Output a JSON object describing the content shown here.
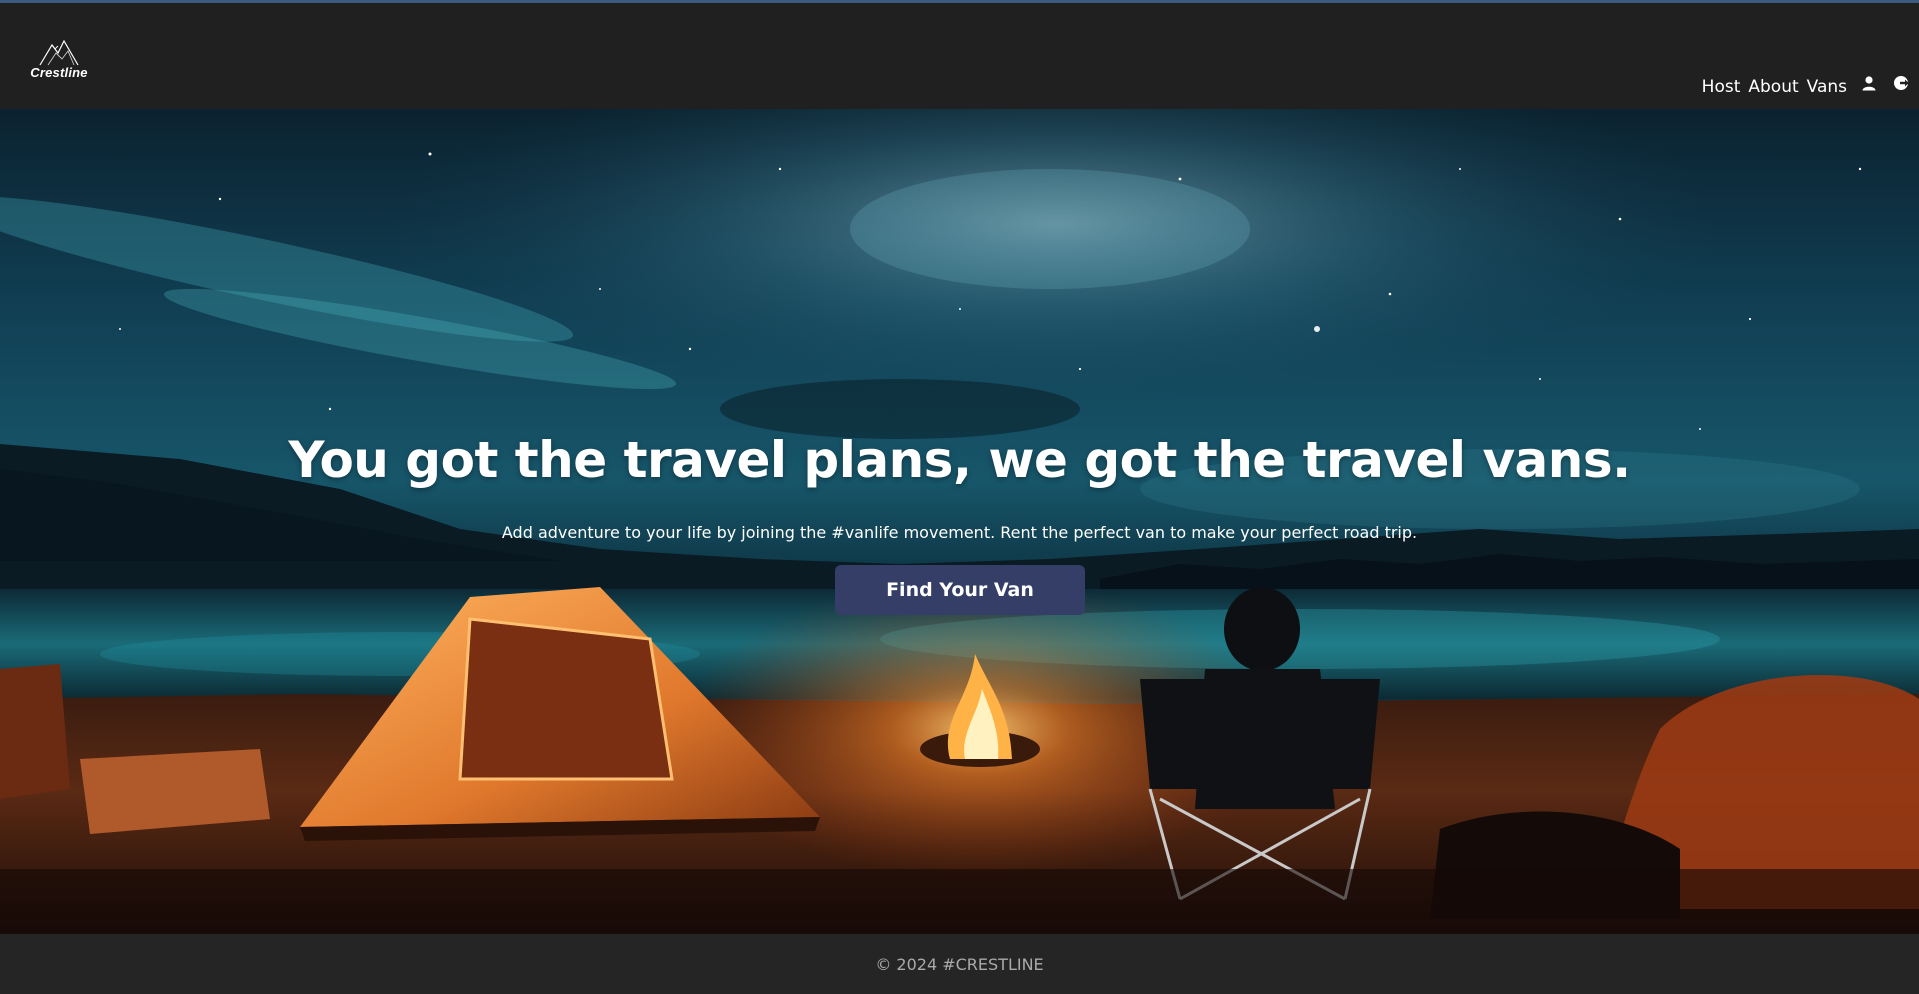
{
  "header": {
    "logo_text": "Crestline",
    "nav": {
      "host": "Host",
      "about": "About",
      "vans": "Vans",
      "profile_icon": "user-icon",
      "logout_icon": "logout-icon"
    }
  },
  "hero": {
    "title": "You got the travel plans, we got the travel vans.",
    "subtitle": "Add adventure to your life by joining the #vanlife movement. Rent the perfect van to make your perfect road trip.",
    "cta_label": "Find Your Van",
    "background": "night sky camping scene with tent and campfire"
  },
  "footer": {
    "copyright": "© 2024 #CRESTLINE"
  },
  "colors": {
    "header_bg": "#202020",
    "footer_bg": "#252525",
    "button_bg": "#343e66",
    "accent_line": "#3d5a80"
  }
}
